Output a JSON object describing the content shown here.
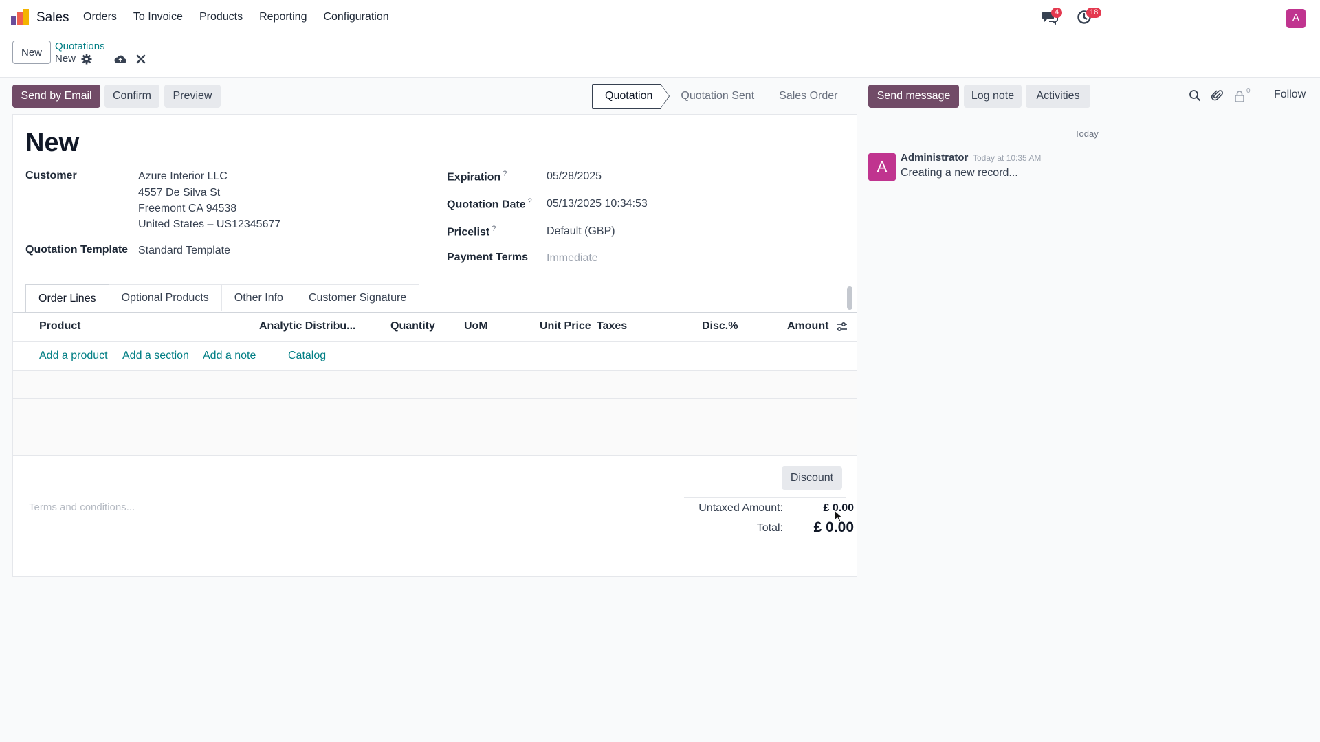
{
  "navbar": {
    "app_name": "Sales",
    "menu": [
      "Orders",
      "To Invoice",
      "Products",
      "Reporting",
      "Configuration"
    ],
    "chat_badge": "4",
    "activity_badge": "18",
    "user_initial": "A"
  },
  "control": {
    "new_button": "New",
    "breadcrumb_parent": "Quotations",
    "breadcrumb_current": "New"
  },
  "actions": {
    "send_by_email": "Send by Email",
    "confirm": "Confirm",
    "preview": "Preview"
  },
  "statusbar": {
    "stages": [
      "Quotation",
      "Quotation Sent",
      "Sales Order"
    ],
    "active": "Quotation"
  },
  "chatter_actions": {
    "send_message": "Send message",
    "log_note": "Log note",
    "activities": "Activities",
    "follower_count": "0",
    "follow": "Follow"
  },
  "form": {
    "title": "New",
    "customer_label": "Customer",
    "customer_lines": [
      "Azure Interior LLC",
      "4557 De Silva St",
      "Freemont CA 94538",
      "United States – US12345677"
    ],
    "template_label": "Quotation Template",
    "template_value": "Standard Template",
    "expiration_label": "Expiration",
    "expiration_value": "05/28/2025",
    "quotation_date_label": "Quotation Date",
    "quotation_date_value": "05/13/2025 10:34:53",
    "pricelist_label": "Pricelist",
    "pricelist_value": "Default (GBP)",
    "payment_terms_label": "Payment Terms",
    "payment_terms_placeholder": "Immediate",
    "help_mark": "?"
  },
  "tabs": [
    "Order Lines",
    "Optional Products",
    "Other Info",
    "Customer Signature"
  ],
  "order_lines": {
    "columns": [
      "Product",
      "Analytic Distribu...",
      "Quantity",
      "UoM",
      "Unit Price",
      "Taxes",
      "Disc.%",
      "Amount"
    ],
    "add_links": [
      "Add a product",
      "Add a section",
      "Add a note",
      "Catalog"
    ]
  },
  "footer": {
    "discount": "Discount",
    "terms_placeholder": "Terms and conditions...",
    "untaxed_label": "Untaxed Amount:",
    "untaxed_value": "£ 0.00",
    "total_label": "Total:",
    "total_value": "£ 0.00"
  },
  "chatter": {
    "date_separator": "Today",
    "messages": [
      {
        "author_initial": "A",
        "author": "Administrator",
        "time": "Today at 10:35 AM",
        "body": "Creating a new record..."
      }
    ]
  },
  "colors": {
    "primary": "#714b67",
    "link": "#017e84",
    "badge": "#e4394f",
    "avatar": "#c0348f"
  }
}
